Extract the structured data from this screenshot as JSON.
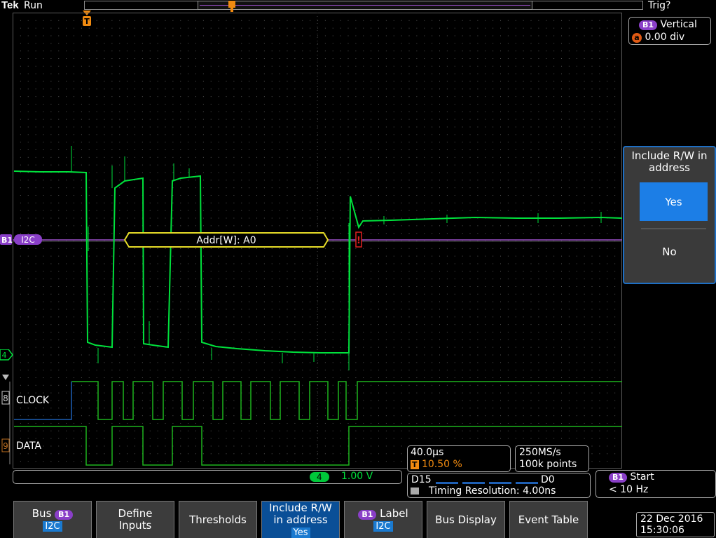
{
  "status": {
    "brand": "Tek",
    "state": "Run",
    "trigger": "Trig?"
  },
  "bus_label": {
    "tag": "B1",
    "protocol": "I2C"
  },
  "decode": {
    "text": "Addr[W]: A0",
    "error_mark": "!"
  },
  "channels": {
    "analog": "4",
    "clock": {
      "num": "8",
      "name": "CLOCK"
    },
    "data": {
      "num": "9",
      "name": "DATA"
    }
  },
  "trigger_marker": "T",
  "vertical_panel": {
    "tag": "B1",
    "title": "Vertical",
    "knob": "a",
    "value": "0.00 div"
  },
  "side_menu": {
    "title": "Include R/W in address",
    "yes": "Yes",
    "no": "No"
  },
  "channel_readout": {
    "num": "4",
    "scale": "1.00 V"
  },
  "horizontal": {
    "scale": "40.0µs",
    "trig_pos": "10.50 %",
    "rate": "250MS/s",
    "points": "100k points"
  },
  "digital": {
    "high": "D15",
    "low": "D0",
    "timing": "Timing Resolution: 4.00ns"
  },
  "trigger_panel": {
    "tag": "B1",
    "type": "Start",
    "freq": "< 10 Hz"
  },
  "datetime": {
    "date": "22 Dec 2016",
    "time": "15:30:06"
  },
  "menu": [
    {
      "label": "Bus",
      "tag": "B1",
      "value": "I2C"
    },
    {
      "label": "Define Inputs"
    },
    {
      "label": "Thresholds"
    },
    {
      "label": "Include R/W in address",
      "value": "Yes"
    },
    {
      "tag": "B1",
      "label": "Label",
      "value": "I2C"
    },
    {
      "label": "Bus Display"
    },
    {
      "label": "Event Table"
    }
  ],
  "colors": {
    "analog": "#00e13c",
    "digital": "#1eb41e",
    "bus": "#9b4fc8",
    "decode_box": "#e6dc28",
    "accent": "#1a7ad0",
    "trigger": "#f08a10"
  }
}
